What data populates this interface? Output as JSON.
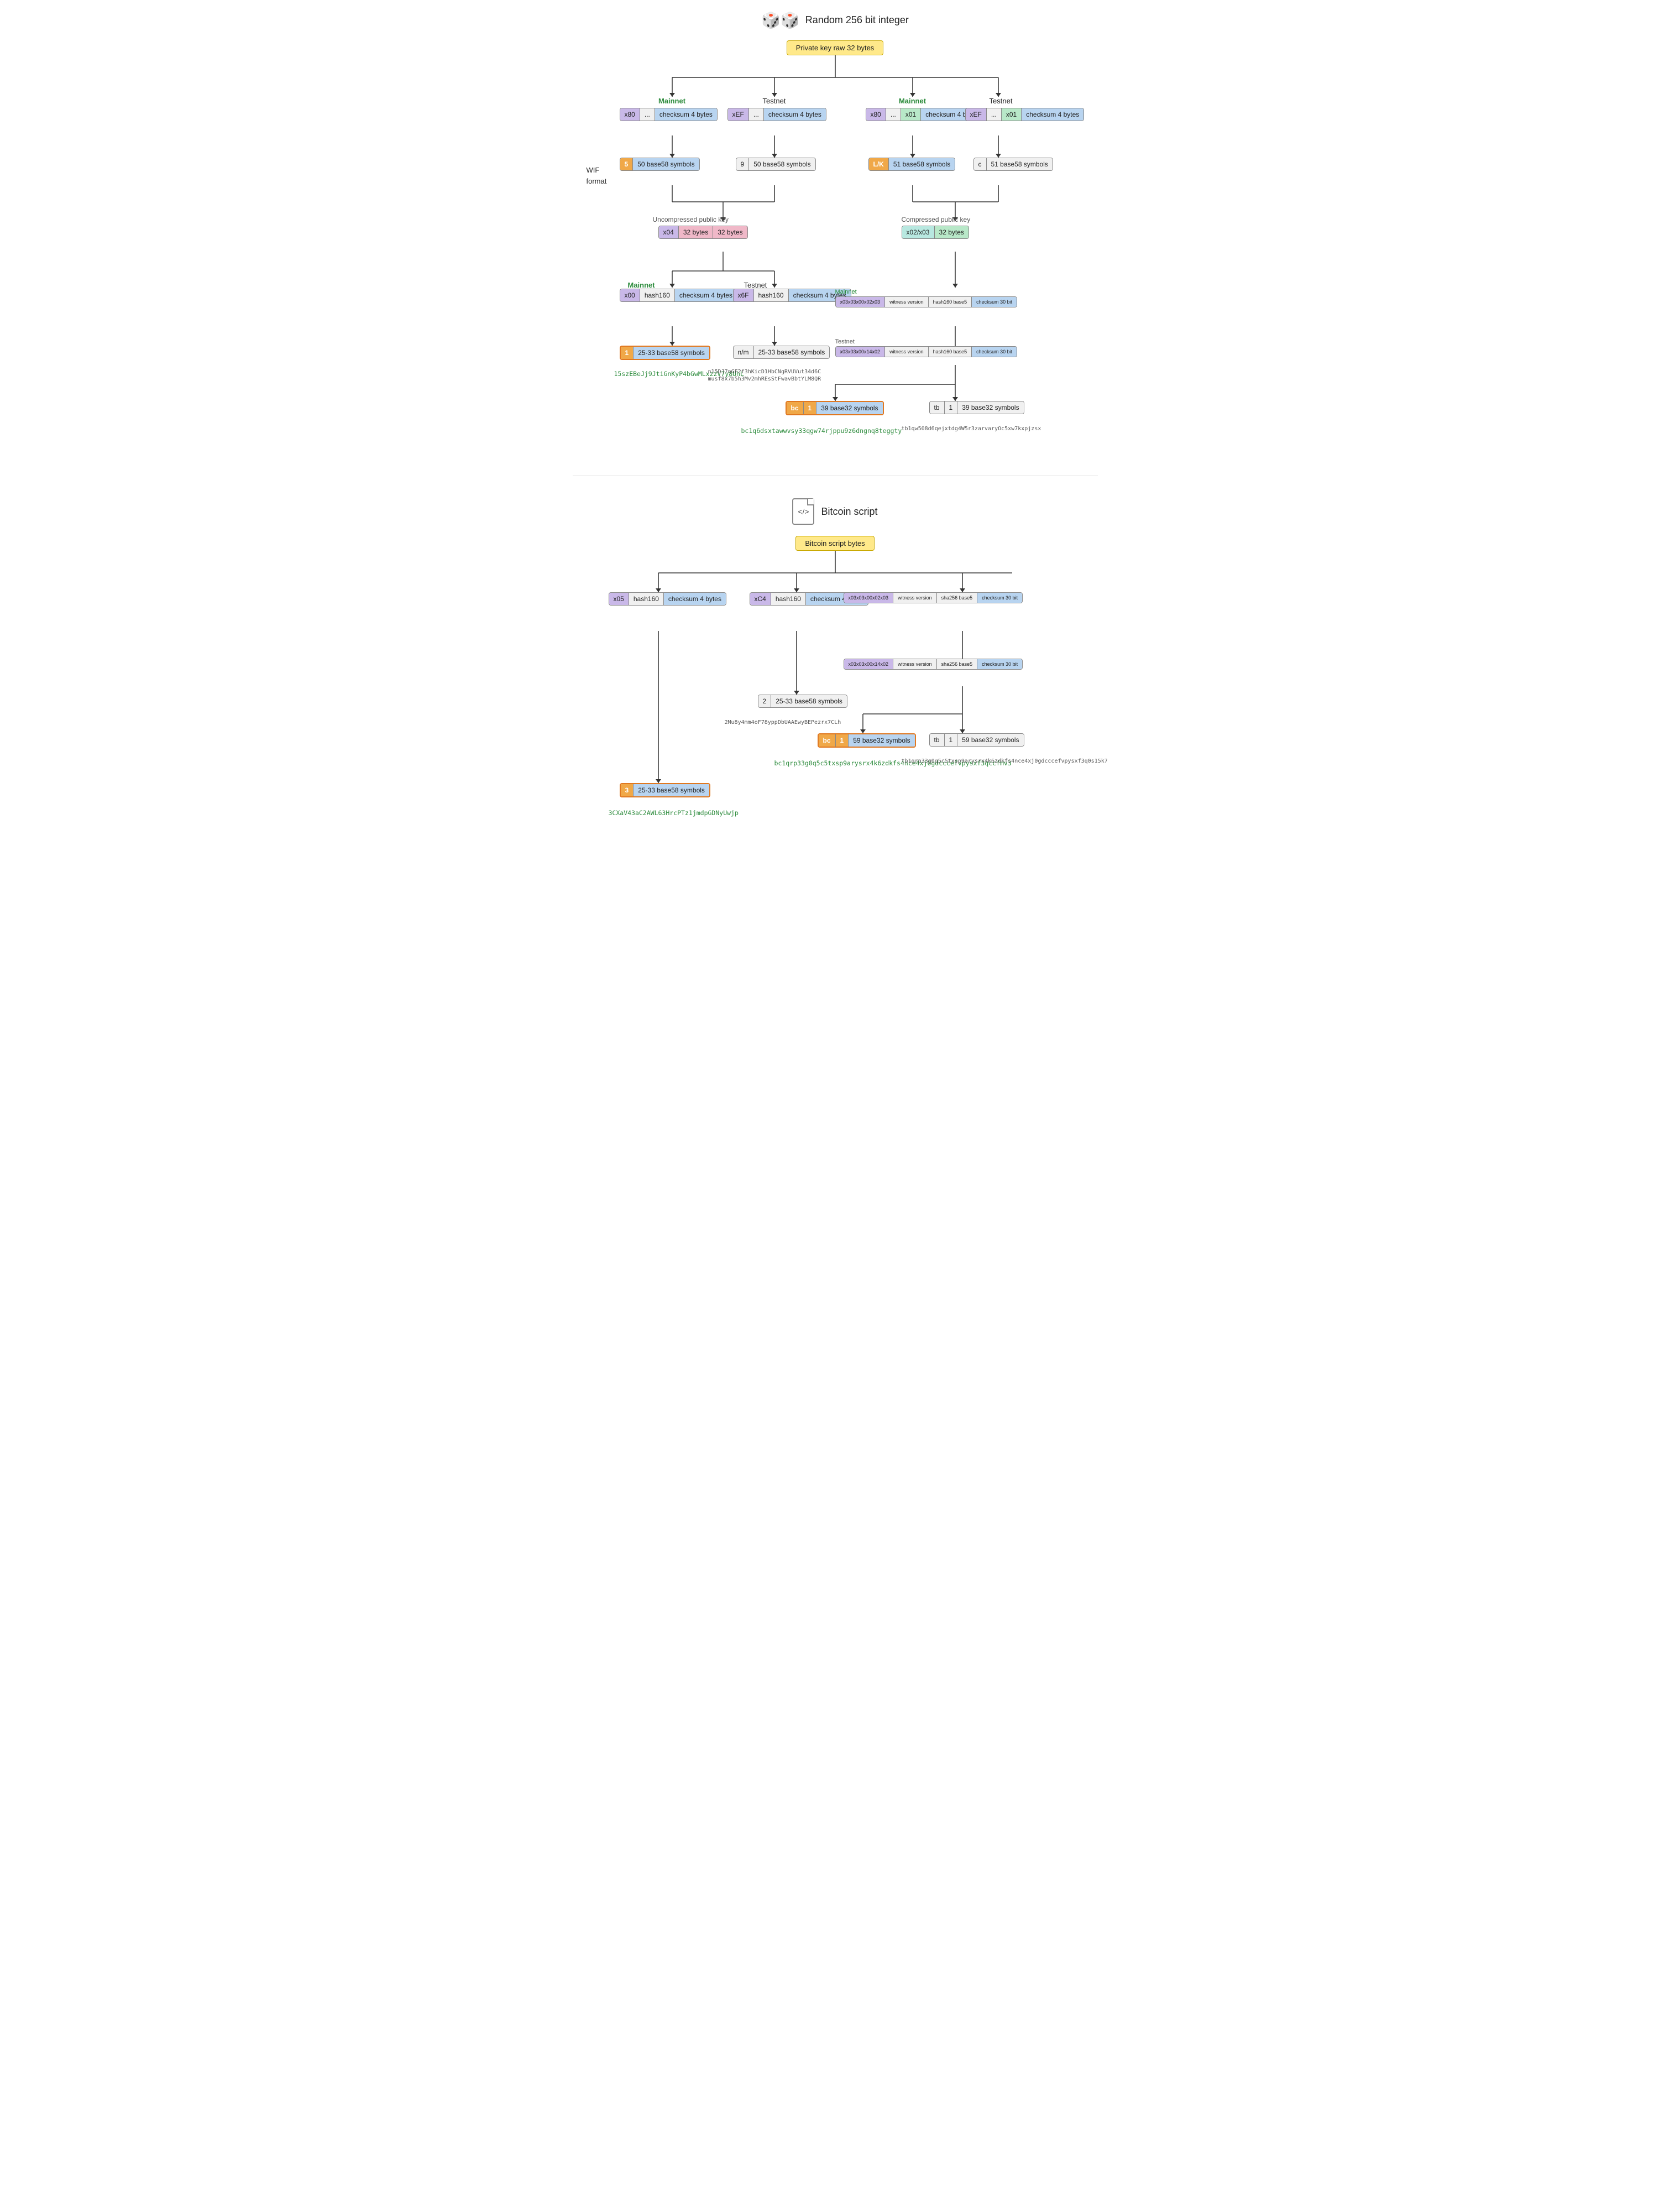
{
  "header": {
    "title": "Random 256 bit integer",
    "dice_icon": "🎲"
  },
  "top_node": {
    "label": "Private key raw 32 bytes"
  },
  "mainnet_label": "Mainnet",
  "testnet_label": "Testnet",
  "wif_label": "WIF\nformat",
  "uncompressed_pk_label": "Uncompressed public key",
  "compressed_pk_label": "Compressed public key",
  "bitcoin_script_title": "Bitcoin script",
  "bitcoin_script_bytes_label": "Bitcoin script bytes",
  "nodes": {
    "mainnet_uncompressed_row": [
      "x80",
      "...",
      "checksum 4 bytes"
    ],
    "testnet_uncompressed_row": [
      "xEF",
      "...",
      "checksum 4 bytes"
    ],
    "mainnet_compressed_row": [
      "x80",
      "...",
      "x01",
      "checksum 4 bytes"
    ],
    "testnet_compressed_row": [
      "xEF",
      "...",
      "x01",
      "checksum 4 bytes"
    ],
    "wif_5": "5",
    "wif_5_label": "50 base58 symbols",
    "wif_9": "9",
    "wif_9_label": "50 base58 symbols",
    "wif_lk": "L/K",
    "wif_lk_label": "51 base58 symbols",
    "wif_c": "c",
    "wif_c_label": "51 base58 symbols",
    "uncompressed_pk_cells": [
      "x04",
      "32 bytes",
      "32 bytes"
    ],
    "compressed_pk_cells": [
      "x02/x03",
      "32 bytes"
    ],
    "mainnet_hash160_row": [
      "x00",
      "hash160",
      "checksum 4 bytes"
    ],
    "testnet_hash160_row": [
      "x6F",
      "hash160",
      "checksum 4 bytes"
    ],
    "mainnet_segwit_row": [
      "x03x03x00x02x03",
      "witness version",
      "hash160 base5",
      "checksum 30 bit"
    ],
    "testnet_segwit_row": [
      "x03x03x00x14x02",
      "witness version",
      "hash160 base5",
      "checksum 30 bit"
    ],
    "p2pkh_mainnet": {
      "prefix": "1",
      "label": "25-33 base58 symbols"
    },
    "p2pkh_testnet": {
      "prefix": "n/m",
      "label": "25-33 base58 symbols"
    },
    "bech32_mainnet": {
      "prefix1": "bc",
      "prefix2": "1",
      "label": "39 base32 symbols"
    },
    "bech32_testnet": {
      "prefix1": "tb",
      "prefix2": "1",
      "label": "39 base32 symbols"
    },
    "addr_p2pkh": "15szEBeJj9JtiGnKyP4bGwMLxzzV7y8UhL",
    "addr_p2pkh_test1": "n15DJ7nGF2f3hKicD1HbCNgRVUVut34d6C",
    "addr_p2pkh_test2": "musf8x7b5h3Mv2mhREsStFwavBbtYLM8QR",
    "addr_bech32_main": "bc1q6dsxtawwvsy33qgw74rjppu9z6dngnq8teggty",
    "addr_bech32_test": "tb1qw508d6qejxtdg4W5r3zarvaryOc5xw7kxpjzsx",
    "script_x05_row": [
      "x05",
      "hash160",
      "checksum 4 bytes"
    ],
    "script_xc4_row": [
      "xC4",
      "hash160",
      "checksum 4 bytes"
    ],
    "script_segwit_main_row": [
      "x03x03x00x02x03",
      "witness version",
      "sha256 base5",
      "checksum 30 bit"
    ],
    "script_segwit_test_row": [
      "x03x03x00x14x02",
      "witness version",
      "sha256 base5",
      "checksum 30 bit"
    ],
    "p2sh_mainnet": {
      "prefix": "3",
      "label": "25-33 base58 symbols"
    },
    "p2sh_testnet": {
      "prefix": "2",
      "label": "25-33 base58 symbols"
    },
    "p2wsh_mainnet": {
      "prefix1": "bc",
      "prefix2": "1",
      "label": "59 base32 symbols"
    },
    "p2wsh_testnet": {
      "prefix1": "tb",
      "prefix2": "1",
      "label": "59 base32 symbols"
    },
    "addr_p2sh": "3CXaV43aC2AWL63HrcPTz1jmdpGDNyUwjp",
    "addr_p2sh_test": "2Mu8y4mm4oF78yppDbUAAEwyBEPezrx7CLh",
    "addr_p2wsh_main": "bc1qrp33g0q5c5txsp9arysrx4k6zdkfs4nce4xj0gdcccefvpysxf3qccfmv3",
    "addr_p2wsh_test": "tb1qrp33g0q5c5txsp9arysrx4k6zdkfs4nce4xj0gdcccefvpysxf3q0s15k7"
  }
}
